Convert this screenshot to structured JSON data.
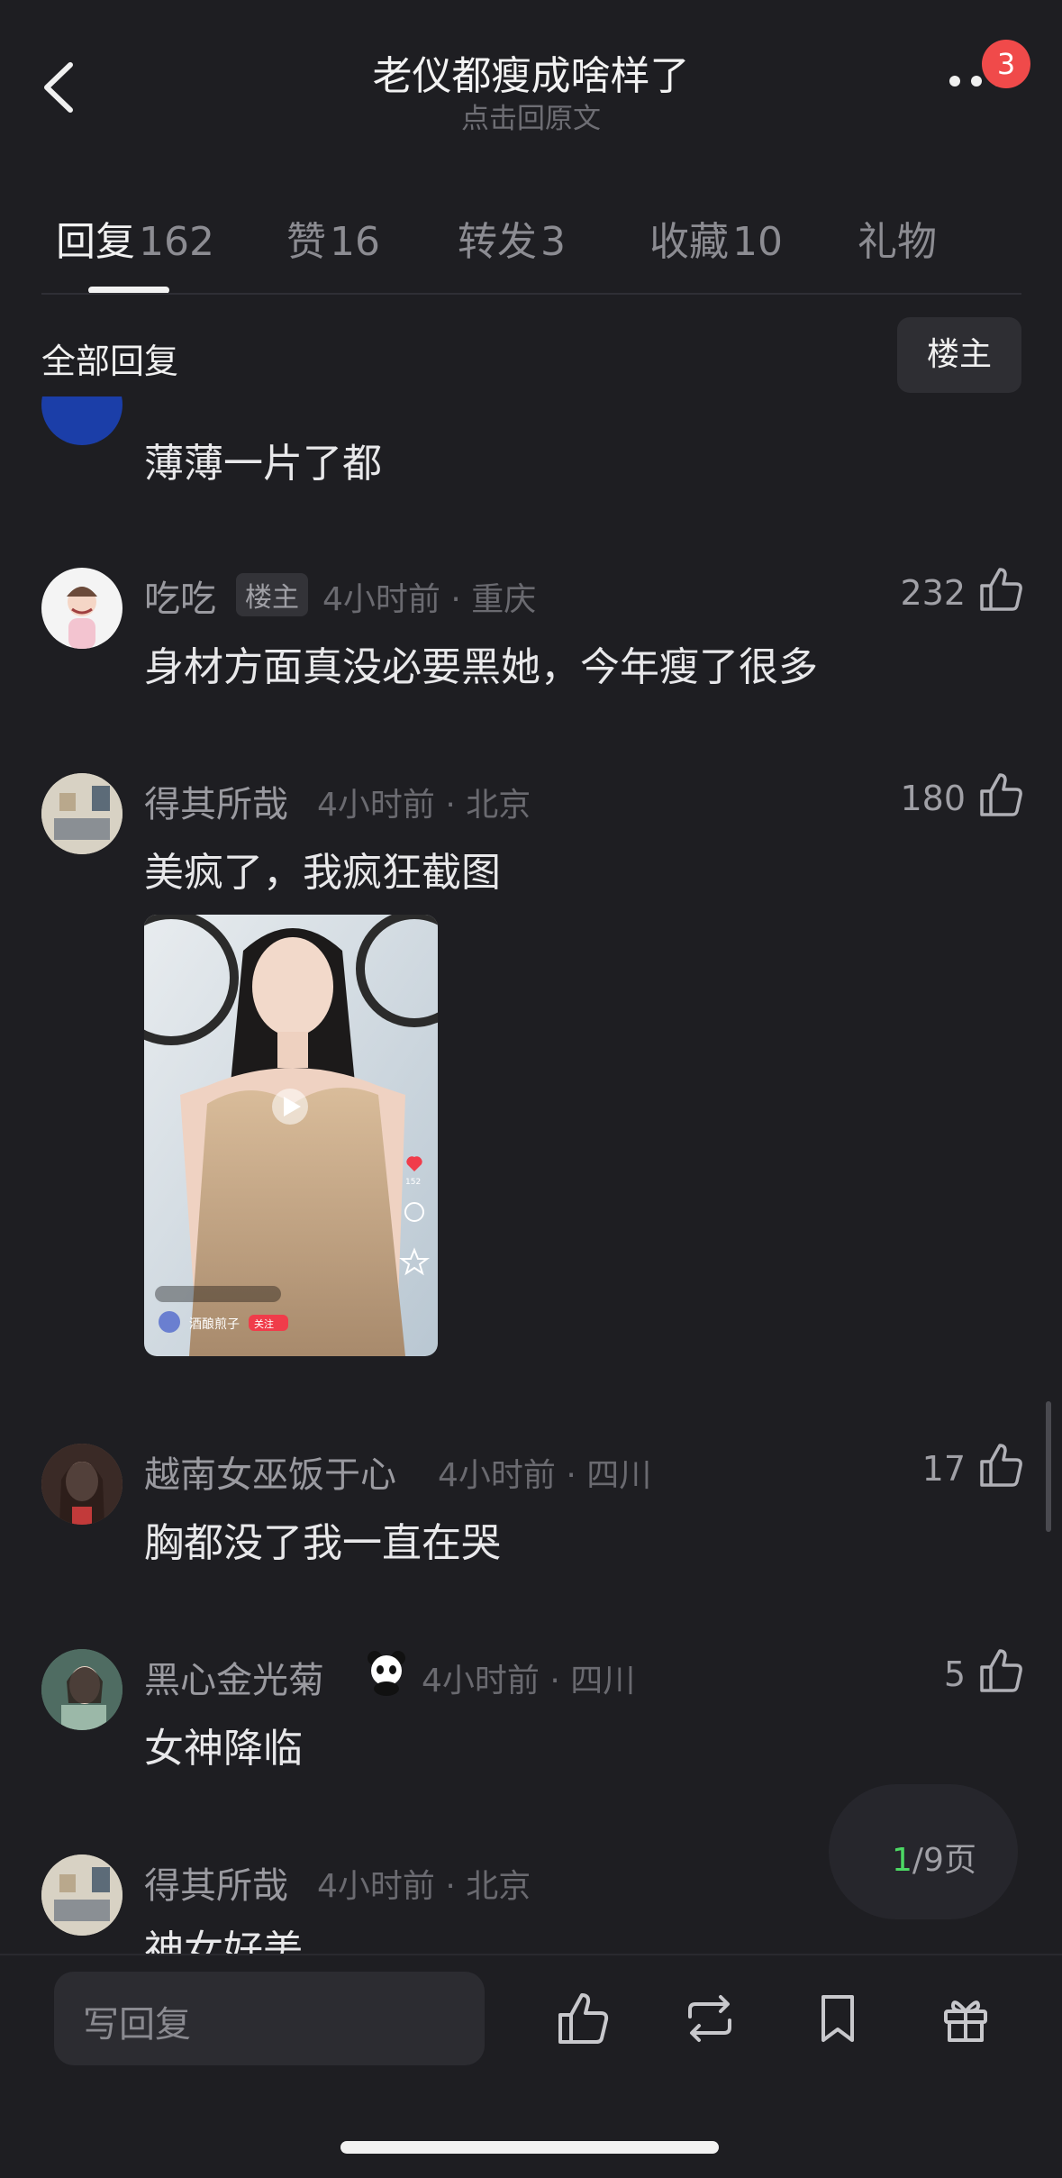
{
  "header": {
    "title": "老仪都瘦成啥样了",
    "subtitle": "点击回原文",
    "notification_count": "3"
  },
  "tabs": [
    {
      "label": "回复",
      "count": "162"
    },
    {
      "label": "赞",
      "count": "16"
    },
    {
      "label": "转发",
      "count": "3"
    },
    {
      "label": "收藏",
      "count": "10"
    },
    {
      "label": "礼物",
      "count": ""
    }
  ],
  "section": {
    "title": "全部回复",
    "filter_label": "楼主"
  },
  "comments": [
    {
      "text": "薄薄一片了都"
    },
    {
      "name": "吃吃",
      "tag": "楼主",
      "meta": "4小时前 · 重庆",
      "likes": "232",
      "text": "身材方面真没必要黑她，今年瘦了很多"
    },
    {
      "name": "得其所哉",
      "meta": "4小时前 · 北京",
      "likes": "180",
      "text": "美疯了，我疯狂截图"
    },
    {
      "name": "越南女巫饭于心",
      "meta": "4小时前 · 四川",
      "likes": "17",
      "text": "胸都没了我一直在哭"
    },
    {
      "name": "黑心金光菊",
      "meta": "4小时前 · 四川",
      "likes": "5",
      "text": "女神降临"
    },
    {
      "name": "得其所哉",
      "meta": "4小时前 · 北京",
      "text": "神女好美"
    }
  ],
  "image_overlay": {
    "user": "酒酿煎子",
    "follow": "关注",
    "like_count": "152"
  },
  "pager": {
    "current": "1",
    "total_label": "/9页"
  },
  "bottom": {
    "reply_placeholder": "写回复"
  }
}
